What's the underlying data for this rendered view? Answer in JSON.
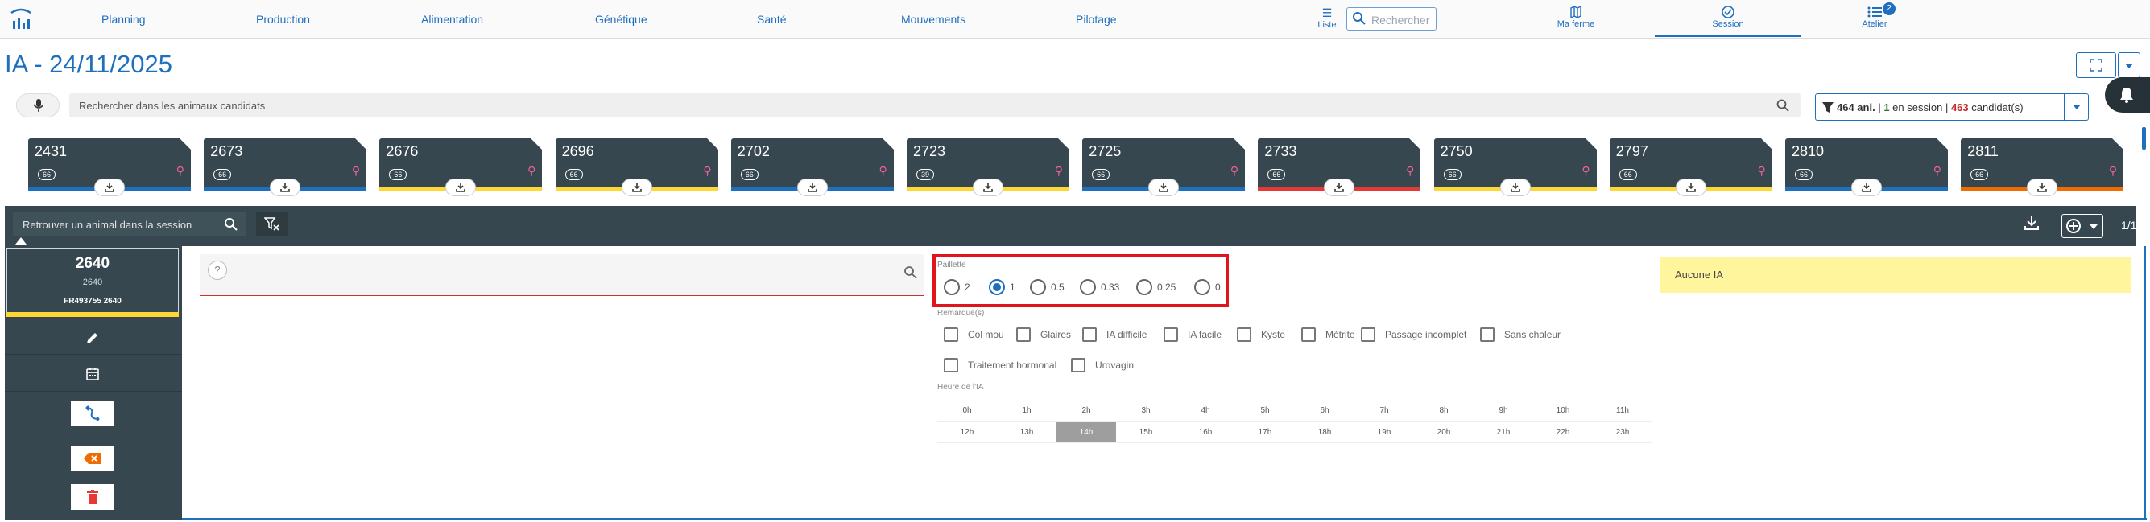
{
  "nav": {
    "links": [
      "Planning",
      "Production",
      "Alimentation",
      "Génétique",
      "Santé",
      "Mouvements",
      "Pilotage"
    ],
    "liste_label": "Liste",
    "search_placeholder": "Rechercher",
    "tabs": [
      {
        "label": "Ma ferme",
        "icon": "map-icon"
      },
      {
        "label": "Session",
        "icon": "session-icon",
        "active": true
      },
      {
        "label": "Atelier",
        "icon": "list-icon",
        "badge": "2"
      }
    ]
  },
  "page": {
    "title": "IA - 24/11/2025"
  },
  "search": {
    "placeholder": "Rechercher dans les animaux candidats",
    "count_animals": "464 ani.",
    "in_session_count": "1",
    "in_session_label": "en session",
    "candidates_count": "463",
    "candidates_label": "candidat(s)"
  },
  "cards": [
    {
      "num": "2431",
      "pill": "66",
      "stripe": "#1f6fbf"
    },
    {
      "num": "2673",
      "pill": "66",
      "stripe": "#1f6fbf"
    },
    {
      "num": "2676",
      "pill": "66",
      "stripe": "#fdd835"
    },
    {
      "num": "2696",
      "pill": "66",
      "stripe": "#fdd835"
    },
    {
      "num": "2702",
      "pill": "66",
      "stripe": "#1f6fbf"
    },
    {
      "num": "2723",
      "pill": "39",
      "stripe": "#fdd835"
    },
    {
      "num": "2725",
      "pill": "66",
      "stripe": "#1f6fbf"
    },
    {
      "num": "2733",
      "pill": "66",
      "stripe": "#e53935"
    },
    {
      "num": "2750",
      "pill": "66",
      "stripe": "#fdd835"
    },
    {
      "num": "2797",
      "pill": "66",
      "stripe": "#fdd835"
    },
    {
      "num": "2810",
      "pill": "66",
      "stripe": "#1f6fbf"
    },
    {
      "num": "2811",
      "pill": "66",
      "stripe": "#ef6c00"
    }
  ],
  "session_bar": {
    "search_placeholder": "Retrouver un animal dans la session",
    "pager": "1/1"
  },
  "animal": {
    "number": "2640",
    "sub": "2640",
    "id": "FR493755  2640"
  },
  "form": {
    "paillette_label": "Paillette",
    "paillette_options": [
      "2",
      "1",
      "0.5",
      "0.33",
      "0.25",
      "0"
    ],
    "paillette_selected": "1",
    "remarques_label": "Remarque(s)",
    "remarques_row1": [
      "Col mou",
      "Glaires",
      "IA difficile",
      "IA facile",
      "Kyste",
      "Métrite",
      "Passage incomplet",
      "Sans chaleur"
    ],
    "remarques_row2": [
      "Traitement hormonal",
      "Urovagin"
    ],
    "heure_label": "Heure de l'IA",
    "hours_row1": [
      "0h",
      "1h",
      "2h",
      "3h",
      "4h",
      "5h",
      "6h",
      "7h",
      "8h",
      "9h",
      "10h",
      "11h"
    ],
    "hours_row2": [
      "12h",
      "13h",
      "14h",
      "15h",
      "16h",
      "17h",
      "18h",
      "19h",
      "20h",
      "21h",
      "22h",
      "23h"
    ],
    "hour_selected": "14h",
    "no_ia": "Aucune IA"
  }
}
